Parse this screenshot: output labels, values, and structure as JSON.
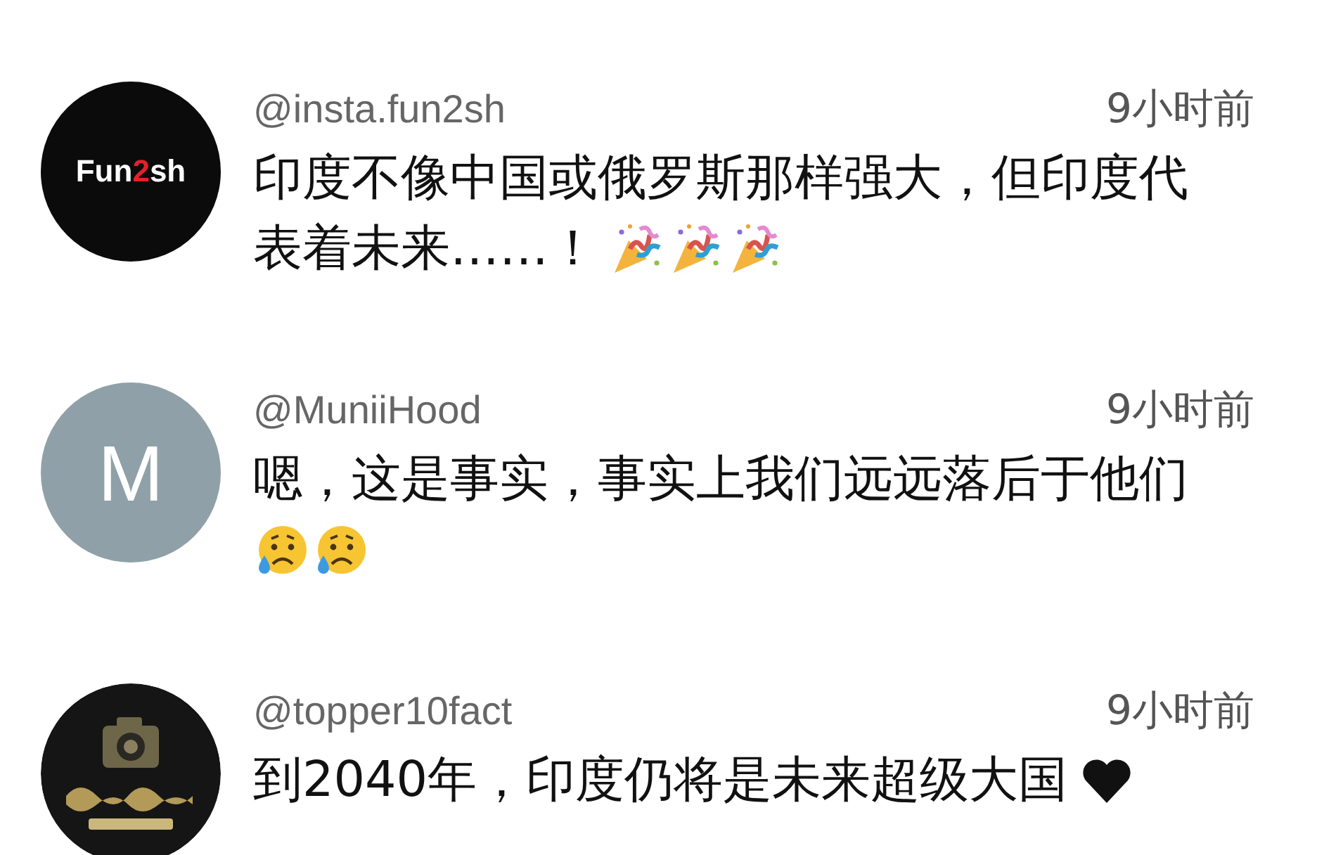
{
  "comments": [
    {
      "avatar": {
        "kind": "logo",
        "parts": [
          {
            "text": "Fun",
            "color": "#ffffff"
          },
          {
            "text": "2",
            "color": "#e3212b"
          },
          {
            "text": "sh",
            "color": "#ffffff"
          }
        ]
      },
      "handle": "@insta.fun2sh",
      "time": "9小时前",
      "lines": [
        {
          "text": "印度不像中国或俄罗斯那样强大，但印度代"
        },
        {
          "text": "表着未来……！",
          "emojis": [
            {
              "kind": "party-popper"
            },
            {
              "kind": "party-popper"
            },
            {
              "kind": "party-popper"
            }
          ]
        }
      ]
    },
    {
      "avatar": {
        "kind": "letter",
        "text": "M"
      },
      "handle": "@MuniiHood",
      "time": "9小时前",
      "lines": [
        {
          "text": "嗯，这是事实，事实上我们远远落后于他们"
        },
        {
          "emojis": [
            {
              "kind": "sad-sweat"
            },
            {
              "kind": "sad-sweat"
            }
          ]
        }
      ]
    },
    {
      "avatar": {
        "kind": "picture"
      },
      "handle": "@topper10fact",
      "time": "9小时前",
      "lines": [
        {
          "text": "到2040年，印度仍将是未来超级大国",
          "emojis": [
            {
              "kind": "heart"
            }
          ]
        }
      ]
    }
  ]
}
